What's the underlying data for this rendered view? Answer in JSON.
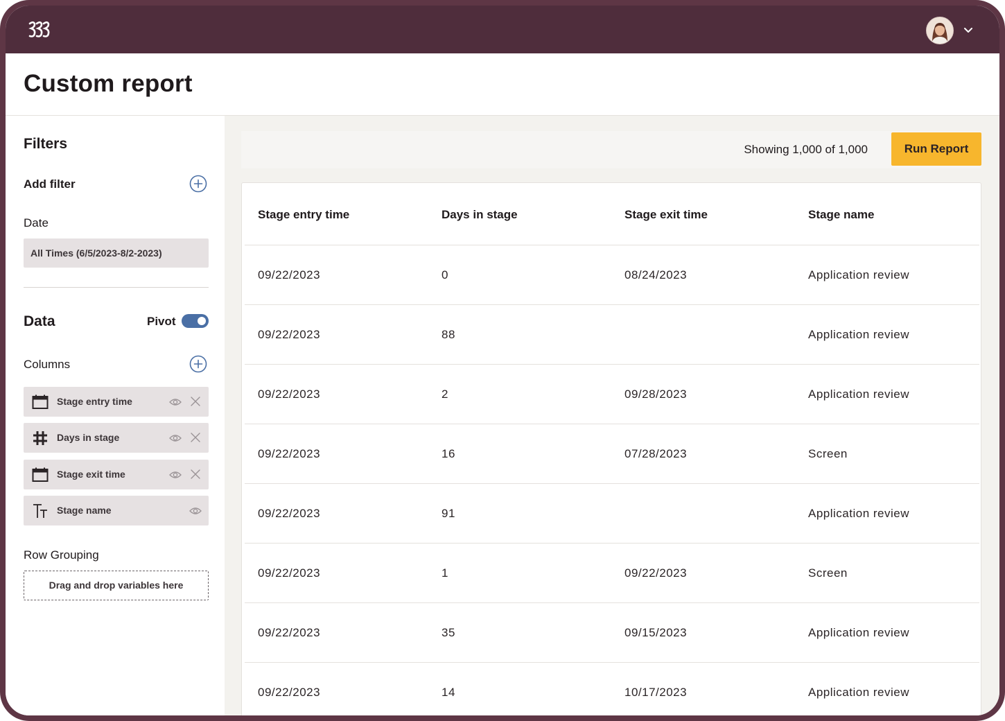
{
  "page": {
    "title": "Custom report"
  },
  "filters": {
    "heading": "Filters",
    "add_filter_label": "Add filter",
    "date_label": "Date",
    "date_value": "All Times (6/5/2023-8/2-2023)"
  },
  "data_panel": {
    "heading": "Data",
    "pivot_label": "Pivot",
    "pivot_on": true,
    "columns_label": "Columns",
    "columns": [
      {
        "name": "Stage entry time",
        "icon": "calendar-icon"
      },
      {
        "name": "Days in stage",
        "icon": "hash-icon"
      },
      {
        "name": "Stage exit time",
        "icon": "calendar-icon"
      },
      {
        "name": "Stage name",
        "icon": "text-icon"
      }
    ],
    "row_grouping_label": "Row Grouping",
    "dropzone_text": "Drag and drop variables here"
  },
  "toolbar": {
    "showing_text": "Showing 1,000 of 1,000",
    "run_label": "Run Report"
  },
  "table": {
    "headers": [
      "Stage entry time",
      "Days in stage",
      "Stage exit time",
      "Stage name"
    ],
    "rows": [
      [
        "09/22/2023",
        "0",
        "08/24/2023",
        "Application review"
      ],
      [
        "09/22/2023",
        "88",
        "",
        "Application review"
      ],
      [
        "09/22/2023",
        "2",
        "09/28/2023",
        "Application review"
      ],
      [
        "09/22/2023",
        "16",
        "07/28/2023",
        "Screen"
      ],
      [
        "09/22/2023",
        "91",
        "",
        "Application review"
      ],
      [
        "09/22/2023",
        "1",
        "09/22/2023",
        "Screen"
      ],
      [
        "09/22/2023",
        "35",
        "09/15/2023",
        "Application review"
      ],
      [
        "09/22/2023",
        "14",
        "10/17/2023",
        "Application review"
      ]
    ]
  },
  "colors": {
    "topbar": "#4f2d3c",
    "accent_button": "#f7b62d",
    "toggle": "#4a6fa5",
    "chip_bg": "#e6e1e2"
  }
}
